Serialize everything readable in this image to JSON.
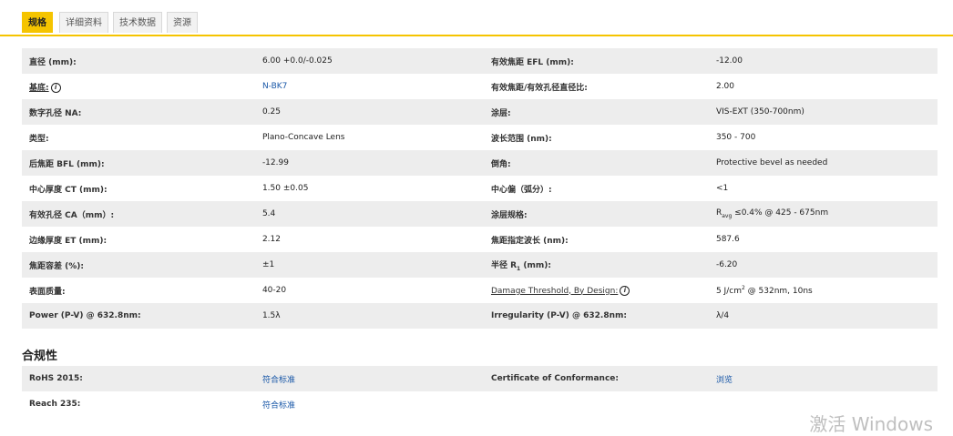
{
  "tabs": [
    "规格",
    "详细资料",
    "技术数据",
    "资源"
  ],
  "specs": [
    {
      "l1": "直径 (mm):",
      "v1": "6.00 +0.0/-0.025",
      "l2": "有效焦距 EFL (mm):",
      "v2": "-12.00"
    },
    {
      "l1": "基底:",
      "v1": "N-BK7",
      "l2": "有效焦距/有效孔径直径比:",
      "v2": "2.00"
    },
    {
      "l1": "数字孔径 NA:",
      "v1": "0.25",
      "l2": "涂层:",
      "v2": "VIS-EXT (350-700nm)"
    },
    {
      "l1": "类型:",
      "v1": "Plano-Concave Lens",
      "l2": "波长范围 (nm):",
      "v2": "350 - 700"
    },
    {
      "l1": "后焦距 BFL (mm):",
      "v1": "-12.99",
      "l2": "倒角:",
      "v2": "Protective bevel as needed"
    },
    {
      "l1": "中心厚度 CT (mm):",
      "v1": "1.50 ±0.05",
      "l2": "中心偏（弧分）:",
      "v2": "<1"
    },
    {
      "l1": "有效孔径 CA（mm）:",
      "v1": "5.4",
      "l2": "涂层规格:",
      "v2_prefix": "R",
      "v2_sub": "avg",
      "v2": "≤0.4% @ 425 - 675nm"
    },
    {
      "l1": "边缘厚度 ET (mm):",
      "v1": "2.12",
      "l2": "焦距指定波长 (nm):",
      "v2": "587.6"
    },
    {
      "l1": "焦距容差 (%):",
      "v1": "±1",
      "l2_prefix": "半径 R",
      "l2_sub": "1",
      "l2": " (mm):",
      "v2": "-6.20"
    },
    {
      "l1": "表面质量:",
      "v1": "40-20",
      "l2": "Damage Threshold, By Design:",
      "v2_prefix": "5 J/cm",
      "v2_sup": "2",
      "v2": " @ 532nm, 10ns"
    },
    {
      "l1": "Power (P-V) @ 632.8nm:",
      "v1": "1.5λ",
      "l2": "Irregularity (P-V) @ 632.8nm:",
      "v2": "λ/4"
    }
  ],
  "info_glyph": "i",
  "compliance_title": "合规性",
  "compliance": [
    {
      "l1": "RoHS 2015:",
      "v1": "符合标准",
      "l2": "Certificate of Conformance:",
      "v2": "浏览"
    },
    {
      "l1": "Reach 235:",
      "v1": "符合标准",
      "l2": "",
      "v2": ""
    }
  ],
  "watermark": "激活 Windows",
  "colors": {
    "accent": "#f5c400",
    "link": "#1a58a8",
    "row_alt": "#ededed"
  }
}
